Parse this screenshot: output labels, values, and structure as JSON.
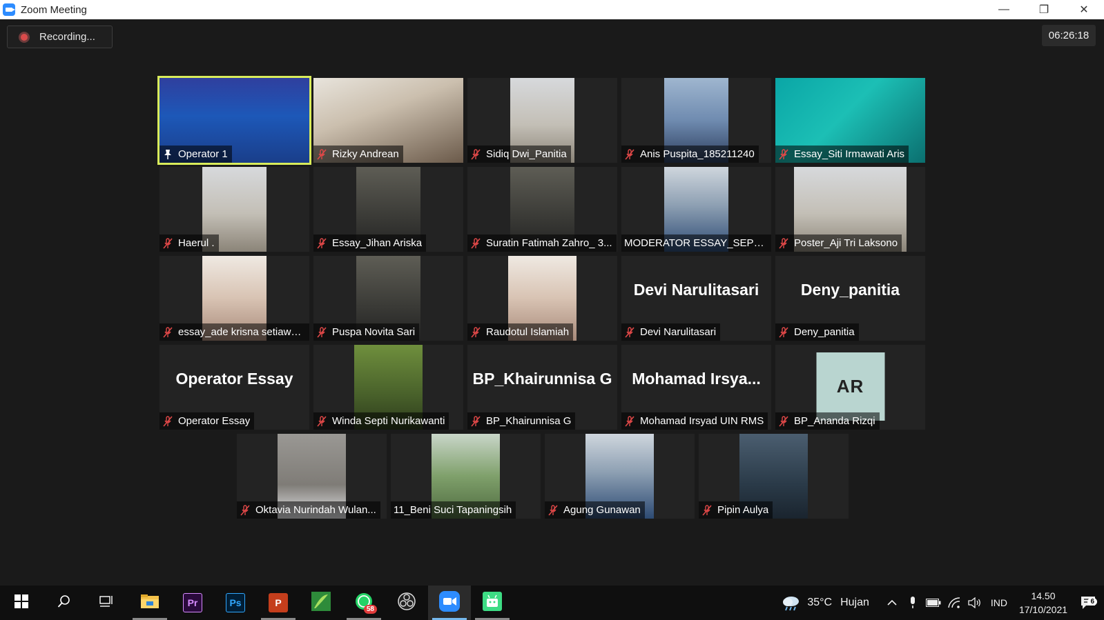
{
  "window": {
    "title": "Zoom Meeting",
    "controls": {
      "minimize": "—",
      "restore": "❐",
      "close": "✕"
    }
  },
  "meeting": {
    "recording_label": "Recording...",
    "elapsed": "06:26:18",
    "participants": [
      {
        "name": "Operator 1",
        "video": true,
        "muted": false,
        "pinned": true,
        "active_speaker": true
      },
      {
        "name": "Rizky Andrean",
        "video": true,
        "muted": true
      },
      {
        "name": "Sidiq Dwi_Panitia",
        "video": true,
        "muted": true
      },
      {
        "name": "Anis Puspita_185211240",
        "video": true,
        "muted": true
      },
      {
        "name": "Essay_Siti Irmawati Aris",
        "video": true,
        "muted": true
      },
      {
        "name": "Haerul .",
        "video": true,
        "muted": true
      },
      {
        "name": "Essay_Jihan Ariska",
        "video": true,
        "muted": true
      },
      {
        "name": "Suratin Fatimah Zahro_ 3...",
        "video": true,
        "muted": true
      },
      {
        "name": "MODERATOR ESSAY_SEPTI B...",
        "video": true,
        "muted": false
      },
      {
        "name": "Poster_Aji Tri Laksono",
        "video": true,
        "muted": true
      },
      {
        "name": "essay_ade krisna setiawa...",
        "video": true,
        "muted": true
      },
      {
        "name": "Puspa Novita Sari",
        "video": true,
        "muted": true
      },
      {
        "name": "Raudotul Islamiah",
        "video": true,
        "muted": true
      },
      {
        "name": "Devi Narulitasari",
        "display_name": "Devi Narulitasari",
        "video": false,
        "muted": true
      },
      {
        "name": "Deny_panitia",
        "display_name": "Deny_panitia",
        "video": false,
        "muted": true
      },
      {
        "name": "Operator Essay",
        "display_name": "Operator Essay",
        "video": false,
        "muted": true
      },
      {
        "name": "Winda Septi Nurikawanti",
        "video": true,
        "muted": true
      },
      {
        "name": "BP_Khairunnisa G",
        "display_name": "BP_Khairunnisa G",
        "video": false,
        "muted": true
      },
      {
        "name": "Mohamad Irsyad UIN RMS",
        "display_name": "Mohamad  Irsya...",
        "video": false,
        "muted": true
      },
      {
        "name": "BP_Ananda Rizqi",
        "avatar_initials": "AR",
        "video": false,
        "muted": true
      },
      {
        "name": "Oktavia Nurindah Wulan...",
        "video": true,
        "muted": true
      },
      {
        "name": "11_Beni Suci Tapaningsih",
        "video": true,
        "muted": false
      },
      {
        "name": "Agung Gunawan",
        "video": true,
        "muted": true
      },
      {
        "name": "Pipin Aulya",
        "video": true,
        "muted": true
      }
    ]
  },
  "taskbar": {
    "apps": [
      {
        "icon": "windows-start-icon"
      },
      {
        "icon": "search-icon"
      },
      {
        "icon": "task-view-icon"
      },
      {
        "icon": "file-explorer-icon",
        "running": true
      },
      {
        "icon": "premiere-pro-icon",
        "label": "Pr"
      },
      {
        "icon": "photoshop-icon",
        "label": "Ps"
      },
      {
        "icon": "powerpoint-icon",
        "label": "P",
        "running": true
      },
      {
        "icon": "corel-icon"
      },
      {
        "icon": "whatsapp-icon",
        "badge": "58",
        "running": true
      },
      {
        "icon": "obs-icon"
      },
      {
        "icon": "zoom-icon",
        "running": true,
        "active": true
      },
      {
        "icon": "android-studio-icon",
        "running": true
      }
    ],
    "weather": {
      "temperature": "35°C",
      "condition": "Hujan"
    },
    "language": "IND",
    "time": "14.50",
    "date": "17/10/2021",
    "notification_count": "6"
  },
  "colors": {
    "active_speaker_border": "#d9ec5a",
    "mic_off_red": "#e04848",
    "zoom_blue": "#2d8cff"
  }
}
